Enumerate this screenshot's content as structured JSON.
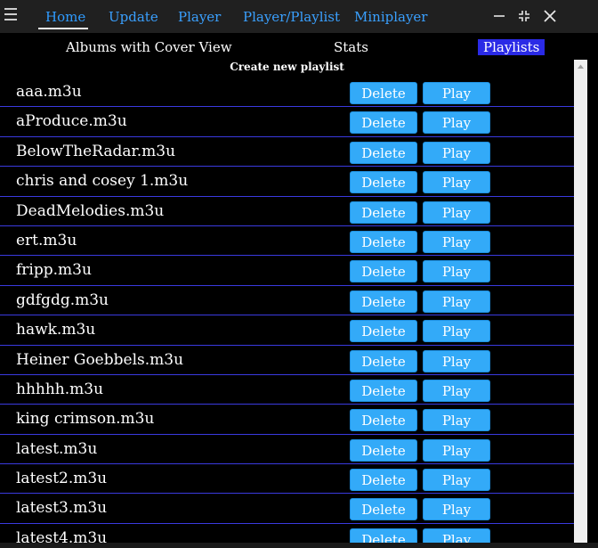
{
  "nav": {
    "tabs": [
      {
        "label": "Home"
      },
      {
        "label": "Update"
      },
      {
        "label": "Player"
      },
      {
        "label": "Player/Playlist"
      },
      {
        "label": "Miniplayer"
      }
    ]
  },
  "subnav": {
    "albums": "Albums with Cover View",
    "stats": "Stats",
    "playlists": "Playlists"
  },
  "create_label": "Create new playlist",
  "buttons": {
    "delete": "Delete",
    "play": "Play"
  },
  "playlists": [
    "aaa.m3u",
    "aProduce.m3u",
    "BelowTheRadar.m3u",
    "chris and cosey 1.m3u",
    "DeadMelodies.m3u",
    "ert.m3u",
    "fripp.m3u",
    "gdfgdg.m3u",
    "hawk.m3u",
    "Heiner Goebbels.m3u",
    "hhhhh.m3u",
    "king crimson.m3u",
    "latest.m3u",
    "latest2.m3u",
    "latest3.m3u",
    "latest4.m3u"
  ],
  "colors": {
    "accent": "#33aaf8",
    "divider": "#3a3adf",
    "active_subnav": "#2a2ae6"
  }
}
